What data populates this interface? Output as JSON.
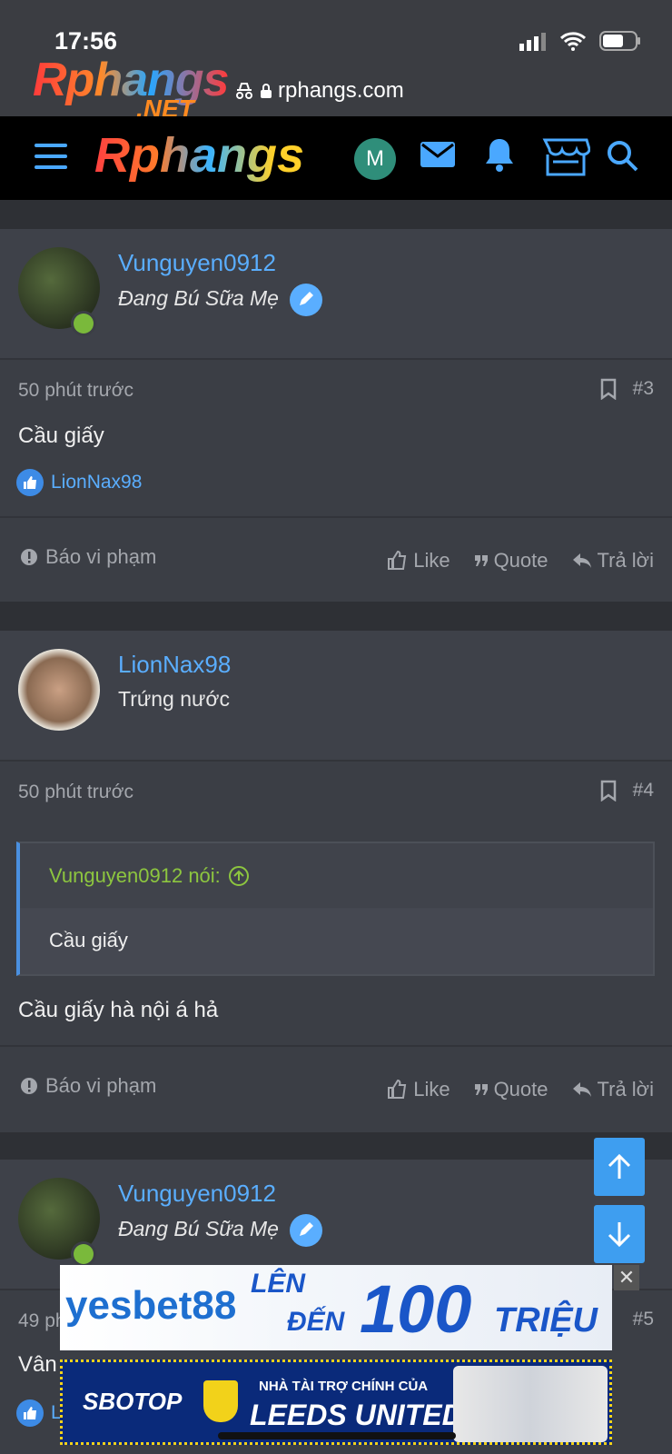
{
  "status": {
    "time": "17:56"
  },
  "browser": {
    "url": "rphangs.com",
    "logo_text": "Rphangs",
    "logo_suffix": ".NET"
  },
  "nav": {
    "logo": "Rphangs",
    "avatar_letter": "M"
  },
  "posts": [
    {
      "username": "Vunguyen0912",
      "user_title": "Đang Bú Sữa Mẹ",
      "time": "50 phút trước",
      "number": "#3",
      "content": "Cầu giấy",
      "reaction_user": "LionNax98",
      "report": "Báo vi phạm",
      "like": "Like",
      "quote": "Quote",
      "reply": "Trả lời"
    },
    {
      "username": "LionNax98",
      "user_title": "Trứng nước",
      "time": "50 phút trước",
      "number": "#4",
      "quote_author": "Vunguyen0912 nói:",
      "quote_text": "Cầu giấy",
      "content": "Cầu giấy hà nội á hả",
      "report": "Báo vi phạm",
      "like": "Like",
      "quote": "Quote",
      "reply": "Trả lời"
    },
    {
      "username": "Vunguyen0912",
      "user_title": "Đang Bú Sữa Mẹ",
      "time": "49 ph",
      "number": "#5",
      "content": "Vân",
      "reaction_user": "L"
    }
  ],
  "ads": {
    "ad1_brand": "yesbet88",
    "ad1_line1": "LÊN",
    "ad1_line2": "ĐẾN",
    "ad1_amount": "100",
    "ad1_unit": "TRIỆU",
    "ad2_brand": "SBOTOP",
    "ad2_line1": "NHÀ TÀI TRỢ CHÍNH CỦA",
    "ad2_line2": "LEEDS UNITED"
  }
}
